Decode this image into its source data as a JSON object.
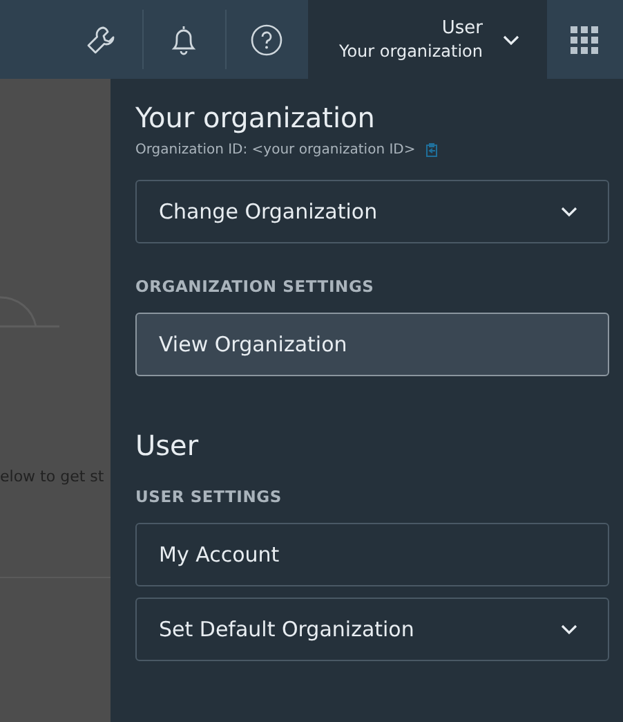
{
  "header": {
    "user_menu": {
      "name": "User",
      "organization": "Your organization",
      "expanded": true
    }
  },
  "background": {
    "hint_text": "elow to get st"
  },
  "panel": {
    "sections": [
      {
        "title": "Your organization",
        "subtitle": "Organization ID: <your organization ID>",
        "items": [
          {
            "kind": "dropdown",
            "label": "Change Organization",
            "selected": false
          }
        ]
      },
      {
        "label": "ORGANIZATION SETTINGS",
        "items": [
          {
            "kind": "button",
            "label": "View Organization",
            "selected": true
          }
        ]
      },
      {
        "title": "User",
        "label": "USER SETTINGS",
        "items": [
          {
            "kind": "button",
            "label": "My Account",
            "selected": false
          },
          {
            "kind": "dropdown",
            "label": "Set Default Organization",
            "selected": false
          }
        ]
      }
    ]
  }
}
